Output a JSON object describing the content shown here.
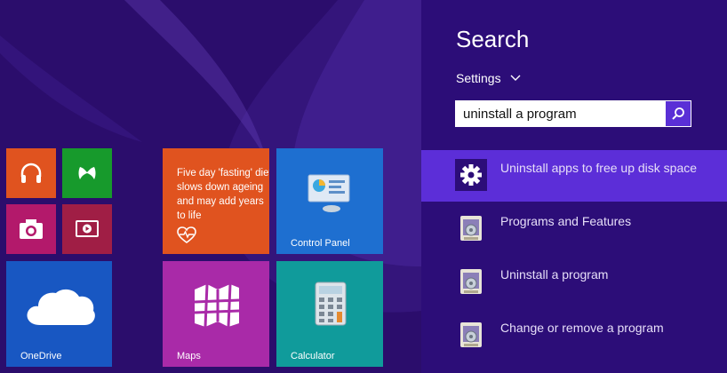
{
  "tiles": {
    "music": {
      "color": "#e0531f"
    },
    "games": {
      "color": "#179a2c"
    },
    "camera": {
      "color": "#b3196b"
    },
    "video": {
      "color": "#a01e45"
    },
    "onedrive": {
      "label": "OneDrive",
      "color": "#1857c2"
    },
    "news": {
      "text": "Five day 'fasting' diet slows down ageing and may add years to life",
      "color": "#e0531f"
    },
    "control_panel": {
      "label": "Control Panel",
      "color": "#1e6fd0"
    },
    "maps": {
      "label": "Maps",
      "color": "#a92aa8"
    },
    "calculator": {
      "label": "Calculator",
      "color": "#109b9b"
    }
  },
  "search_panel": {
    "title": "Search",
    "scope_label": "Settings",
    "query": "uninstall a program",
    "results": [
      {
        "text": "Uninstall apps to free up disk space",
        "selected": true
      },
      {
        "text": "Programs and Features",
        "selected": false
      },
      {
        "text": "Uninstall a program",
        "selected": false
      },
      {
        "text": "Change or remove a program",
        "selected": false
      }
    ]
  },
  "colors": {
    "background": "#2b0d6c",
    "panel": "#2c0d78",
    "selection": "#5c2ed8",
    "search_button": "#5a2fd6"
  }
}
